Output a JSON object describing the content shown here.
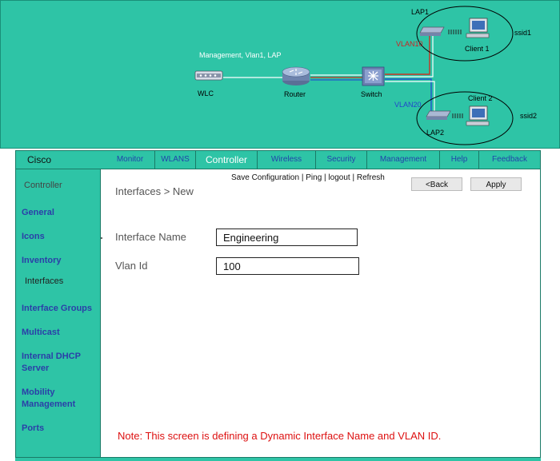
{
  "topology": {
    "nodes": {
      "wlc": "WLC",
      "router": "Router",
      "switch": "Switch",
      "lap1": "LAP1",
      "lap2": "LAP2",
      "client1": "Client 1",
      "client2": "Client 2"
    },
    "management_label": "Management, Vlan1, LAP",
    "vlan10_label": "VLAN10",
    "vlan20_label": "VLAN20",
    "ssid1": "ssid1",
    "ssid2": "ssid2"
  },
  "controller": {
    "brand": "Cisco",
    "menu": [
      {
        "label": "Monitor"
      },
      {
        "label": "WLANS"
      },
      {
        "label": "Controller"
      },
      {
        "label": "Wireless"
      },
      {
        "label": "Security"
      },
      {
        "label": "Management"
      },
      {
        "label": "Help"
      },
      {
        "label": "Feedback"
      }
    ],
    "active_menu": "Controller",
    "sidebar": {
      "heading": "Controller",
      "items": [
        {
          "label": "General"
        },
        {
          "label": "Icons"
        },
        {
          "label": "Inventory"
        },
        {
          "label": "Interfaces"
        },
        {
          "label": "Interface Groups"
        },
        {
          "label": "Multicast"
        },
        {
          "label": "Internal DHCP Server"
        },
        {
          "label": "Mobility Management"
        },
        {
          "label": "Ports"
        }
      ]
    },
    "top_links": {
      "save": "Save Configuration",
      "ping": "Ping",
      "logout": "logout",
      "refresh": "Refresh",
      "sep": "|"
    },
    "buttons": {
      "back": "<Back",
      "apply": "Apply"
    },
    "breadcrumb": "Interfaces > New",
    "form": {
      "interface_name_label": "Interface Name",
      "interface_name_value": "Engineering",
      "vlan_id_label": "Vlan Id",
      "vlan_id_value": "100"
    },
    "note": "Note: This screen is defining a Dynamic Interface Name and VLAN ID."
  },
  "colors": {
    "teal_bg": "#2ec4a6",
    "link_blue": "#2b3fa8",
    "note_red": "#dd1111",
    "vlan10_red": "#cc2222",
    "vlan20_blue": "#2244cc"
  },
  "icons": [
    "router-icon",
    "switch-icon",
    "wlc-icon",
    "access-point-icon",
    "pc-icon"
  ]
}
